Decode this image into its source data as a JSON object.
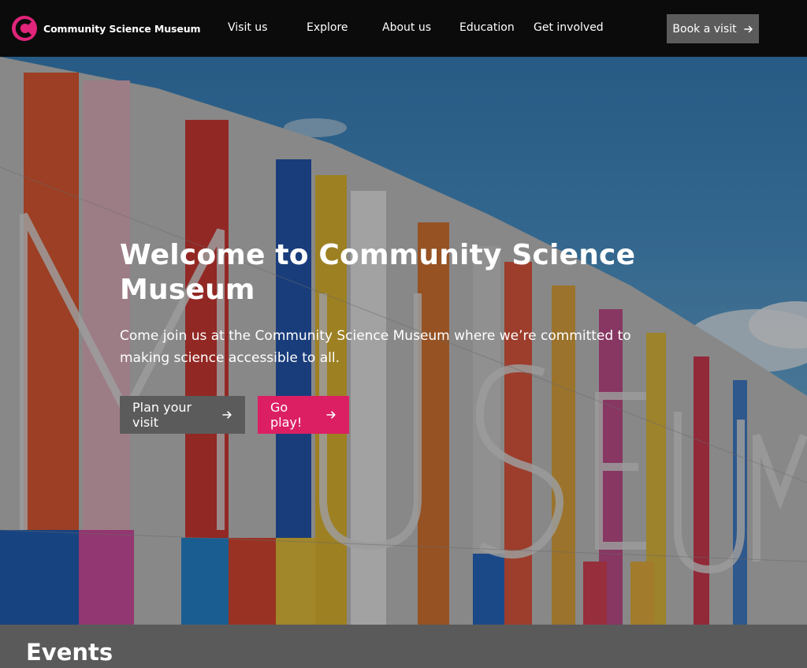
{
  "brand": {
    "name": "Community Science Museum",
    "logo_icon": "c-logo-icon",
    "logo_color": "#e0257a"
  },
  "nav": {
    "links": [
      "Visit us",
      "Explore",
      "About us",
      "Education",
      "Get involved"
    ],
    "book_button": {
      "label": "Book a visit",
      "icon": "arrow-right-icon"
    }
  },
  "hero": {
    "title": "Welcome to Community Science Museum",
    "description": "Come join us at the Community Science Museum where we’re committed to making science accessible to all.",
    "buttons": [
      {
        "label": "Plan your visit",
        "icon": "arrow-right-icon",
        "color": "#5b5b5b"
      },
      {
        "label": "Go play!",
        "icon": "arrow-right-icon",
        "color": "#dc1f63"
      }
    ],
    "background_image": "colorful museum building facade with large MUSEUM letters"
  },
  "events": {
    "title": "Events"
  },
  "colors": {
    "nav_bg": "#0b0b0b",
    "accent": "#dc1f63",
    "button_gray": "#5b5b5b",
    "section_bg": "#5a5a5a"
  }
}
